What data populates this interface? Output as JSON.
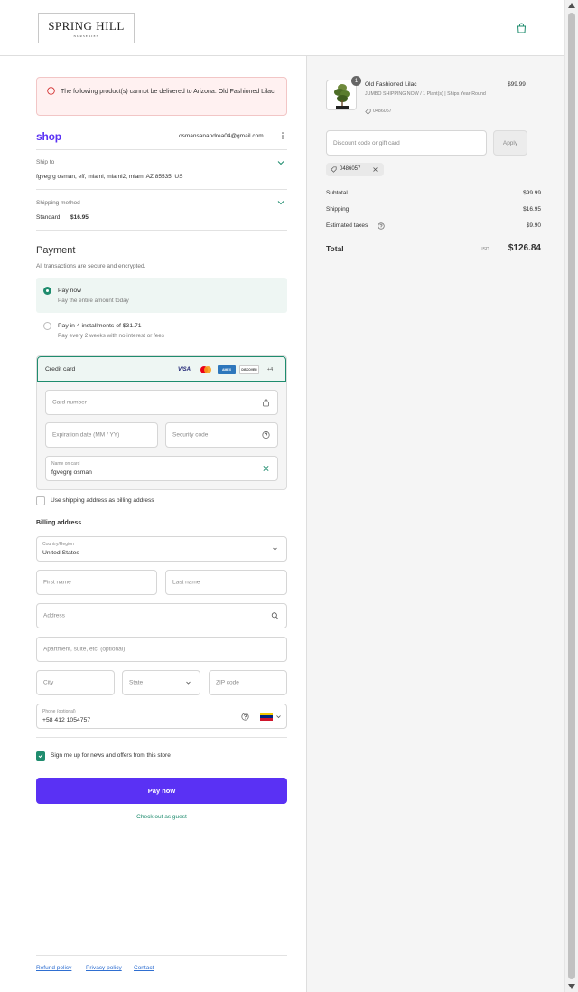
{
  "brand": {
    "logo_line1": "SPRING HILL",
    "logo_line2": "NURSERIES"
  },
  "alert": {
    "text": "The following product(s) cannot be delivered to Arizona: Old Fashioned Lilac"
  },
  "account": {
    "shop_label": "shop",
    "email": "osmansanandrea04@gmail.com"
  },
  "ship_to": {
    "label": "Ship to",
    "value": "fgvegrg osman, eff, miami, miami2, miami AZ 85535, US"
  },
  "shipping_method": {
    "label": "Shipping method",
    "name": "Standard",
    "price": "$16.95"
  },
  "payment": {
    "title": "Payment",
    "subtitle": "All transactions are secure and encrypted.",
    "options": [
      {
        "title": "Pay now",
        "subtitle": "Pay the entire amount today",
        "selected": true
      },
      {
        "title": "Pay in 4 installments of $31.71",
        "subtitle": "Pay every 2 weeks with no interest or fees",
        "selected": false
      }
    ],
    "credit_card": {
      "label": "Credit card",
      "brands": [
        "VISA",
        "Mastercard",
        "AMEX",
        "DISCOVER"
      ],
      "more": "+4",
      "card_number_placeholder": "Card number",
      "expiry_placeholder": "Expiration date (MM / YY)",
      "security_placeholder": "Security code",
      "name_label": "Name on card",
      "name_value": "fgvegrg osman"
    },
    "use_shipping_as_billing": "Use shipping address as billing address"
  },
  "billing": {
    "title": "Billing address",
    "country_label": "Country/Region",
    "country_value": "United States",
    "first_name": "First name",
    "last_name": "Last name",
    "address": "Address",
    "apartment": "Apartment, suite, etc. (optional)",
    "city": "City",
    "state": "State",
    "zip": "ZIP code",
    "phone_label": "Phone (optional)",
    "phone_value": "+58 412 1054757"
  },
  "newsletter": {
    "label": "Sign me up for news and offers from this store",
    "checked": true
  },
  "pay_button": "Pay now",
  "guest_link": "Check out as guest",
  "footer": {
    "links": [
      "Refund policy",
      "Privacy policy",
      "Contact"
    ]
  },
  "order": {
    "item": {
      "quantity": "1",
      "name": "Old Fashioned Lilac",
      "variant": "JUMBO SHIPPING NOW / 1 Plant(s) | Ships Year-Round",
      "code": "0486057",
      "price": "$99.99"
    },
    "discount_placeholder": "Discount code or gift card",
    "apply_label": "Apply",
    "applied_code": "0486057",
    "subtotal_label": "Subtotal",
    "subtotal": "$99.99",
    "shipping_label": "Shipping",
    "shipping": "$16.95",
    "taxes_label": "Estimated taxes",
    "taxes": "$9.90",
    "total_label": "Total",
    "currency": "USD",
    "total": "$126.84"
  },
  "colors": {
    "accent_green": "#1f8c6e",
    "pay_purple": "#5a31f4",
    "alert_bg": "#fff1f1"
  }
}
